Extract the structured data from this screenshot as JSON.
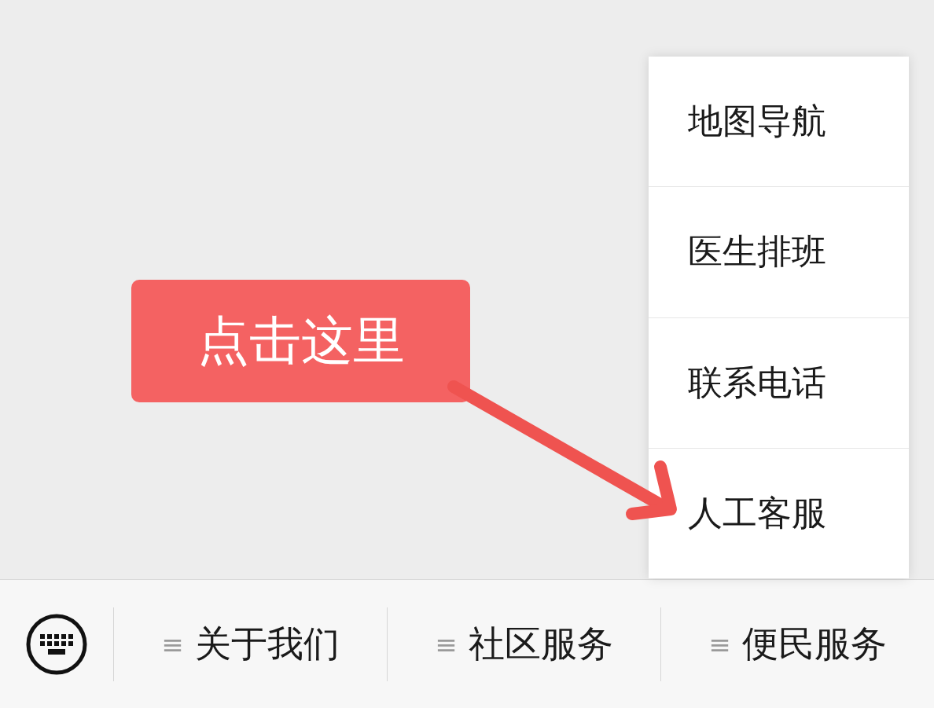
{
  "popup_menu": {
    "items": [
      {
        "label": "地图导航"
      },
      {
        "label": "医生排班"
      },
      {
        "label": "联系电话"
      },
      {
        "label": "人工客服"
      }
    ]
  },
  "annotation": {
    "label": "点击这里"
  },
  "bottom_bar": {
    "menus": [
      {
        "icon": "≡",
        "label": "关于我们"
      },
      {
        "icon": "≡",
        "label": "社区服务"
      },
      {
        "icon": "≡",
        "label": "便民服务"
      }
    ]
  }
}
